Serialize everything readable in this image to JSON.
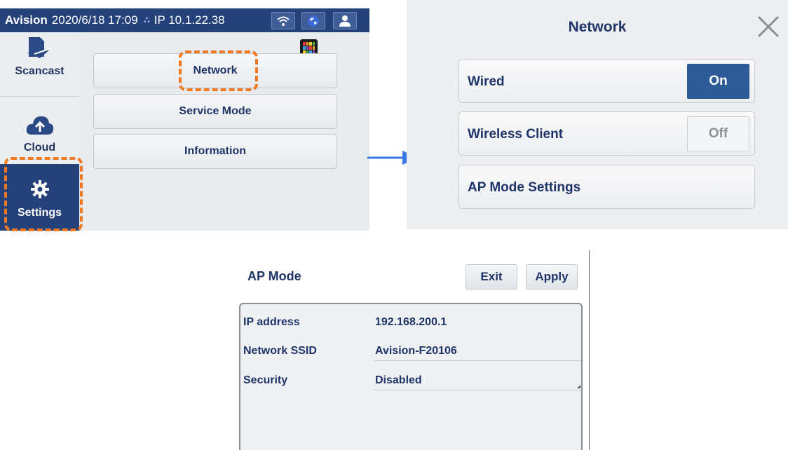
{
  "settings_screen": {
    "statusbar": {
      "brand": "Avision",
      "datetime": "2020/6/18 17:09",
      "ip": "IP 10.1.22.38"
    },
    "sidebar": [
      {
        "label": "Scancast",
        "icon": "scancast-icon"
      },
      {
        "label": "Cloud",
        "icon": "cloud-upload-icon"
      },
      {
        "label": "Settings",
        "icon": "gear-icon",
        "active": true
      }
    ],
    "menu": [
      "Network",
      "Service Mode",
      "Information"
    ]
  },
  "network_dialog": {
    "title": "Network",
    "rows": [
      {
        "label": "Wired",
        "toggle": "On",
        "state": "on"
      },
      {
        "label": "Wireless Client",
        "toggle": "Off",
        "state": "off"
      },
      {
        "label": "AP Mode Settings"
      }
    ]
  },
  "ap_mode": {
    "title": "AP Mode",
    "exit_label": "Exit",
    "apply_label": "Apply",
    "fields": [
      {
        "label": "IP address",
        "value": "192.168.200.1"
      },
      {
        "label": "Network SSID",
        "value": "Avision-F20106"
      },
      {
        "label": "Security",
        "value": "Disabled"
      }
    ]
  },
  "colors": {
    "primary": "#25417a",
    "text": "#1f3468",
    "highlight": "#f07a24",
    "arrow": "#3b78e7"
  }
}
